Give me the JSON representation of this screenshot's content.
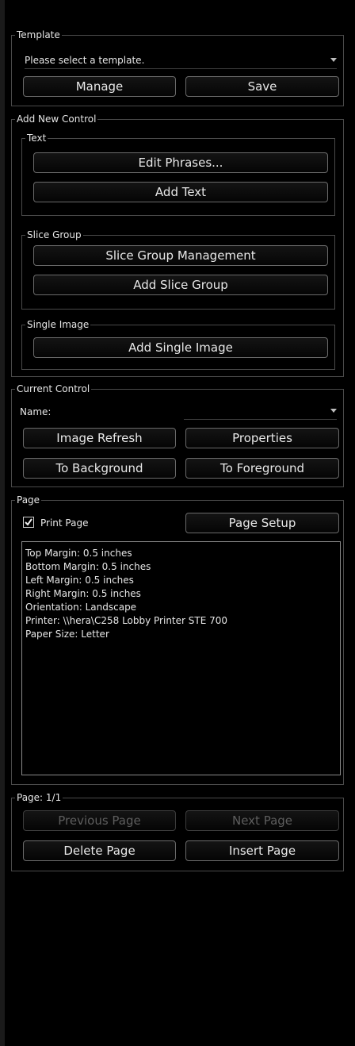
{
  "template": {
    "group_label": "Template",
    "select_value": "Please select a template.",
    "manage_label": "Manage",
    "save_label": "Save"
  },
  "add_new_control": {
    "group_label": "Add New Control",
    "text": {
      "group_label": "Text",
      "edit_phrases_label": "Edit Phrases...",
      "add_text_label": "Add Text"
    },
    "slice_group": {
      "group_label": "Slice Group",
      "management_label": "Slice Group Management",
      "add_label": "Add Slice Group"
    },
    "single_image": {
      "group_label": "Single Image",
      "add_label": "Add Single Image"
    }
  },
  "current_control": {
    "group_label": "Current Control",
    "name_label": "Name:",
    "name_value": "",
    "image_refresh_label": "Image Refresh",
    "properties_label": "Properties",
    "to_background_label": "To Background",
    "to_foreground_label": "To Foreground"
  },
  "page": {
    "group_label": "Page",
    "print_page_label": "Print Page",
    "print_page_checked": true,
    "page_setup_label": "Page Setup",
    "info_lines": [
      "Top Margin: 0.5 inches",
      "Bottom Margin: 0.5 inches",
      "Left Margin: 0.5 inches",
      "Right Margin: 0.5 inches",
      "Orientation: Landscape",
      "Printer: \\\\hera\\C258 Lobby Printer STE 700",
      "Paper Size: Letter"
    ]
  },
  "pagination": {
    "group_label": "Page: 1/1",
    "previous_label": "Previous Page",
    "next_label": "Next Page",
    "delete_label": "Delete Page",
    "insert_label": "Insert Page",
    "previous_enabled": false,
    "next_enabled": false
  },
  "colors": {
    "background": "#000000",
    "text": "#e8e8e8",
    "border": "#4a4a4a",
    "disabled_text": "#5e5e5e"
  }
}
